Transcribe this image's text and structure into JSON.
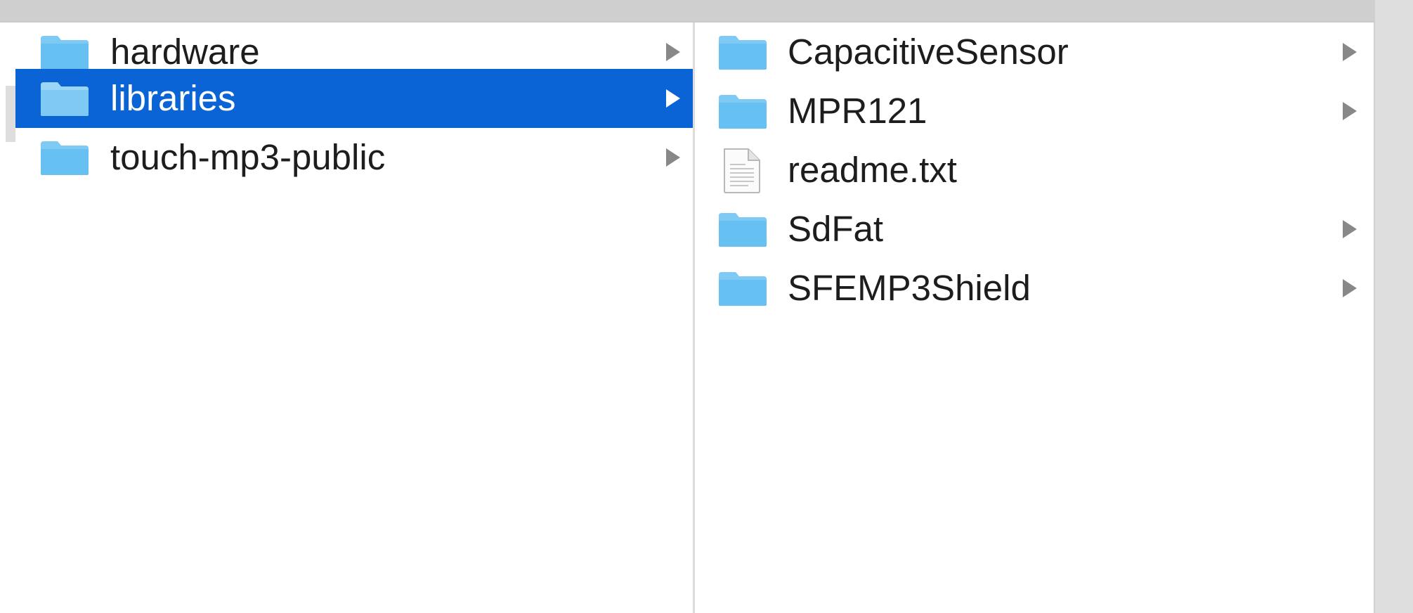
{
  "colors": {
    "selection": "#0a64d6",
    "folder": "#66c0f2",
    "folder_tab": "#7fcaf4",
    "chevron": "#888888"
  },
  "column1": {
    "items": [
      {
        "label": "hardware",
        "icon": "folder-icon",
        "has_children": true,
        "selected": false
      },
      {
        "label": "libraries",
        "icon": "folder-icon",
        "has_children": true,
        "selected": true
      },
      {
        "label": "touch-mp3-public",
        "icon": "folder-icon",
        "has_children": true,
        "selected": false
      }
    ]
  },
  "column2": {
    "items": [
      {
        "label": "CapacitiveSensor",
        "icon": "folder-icon",
        "has_children": true
      },
      {
        "label": "MPR121",
        "icon": "folder-icon",
        "has_children": true
      },
      {
        "label": "readme.txt",
        "icon": "text-file-icon",
        "has_children": false
      },
      {
        "label": "SdFat",
        "icon": "folder-icon",
        "has_children": true
      },
      {
        "label": "SFEMP3Shield",
        "icon": "folder-icon",
        "has_children": true
      }
    ]
  }
}
